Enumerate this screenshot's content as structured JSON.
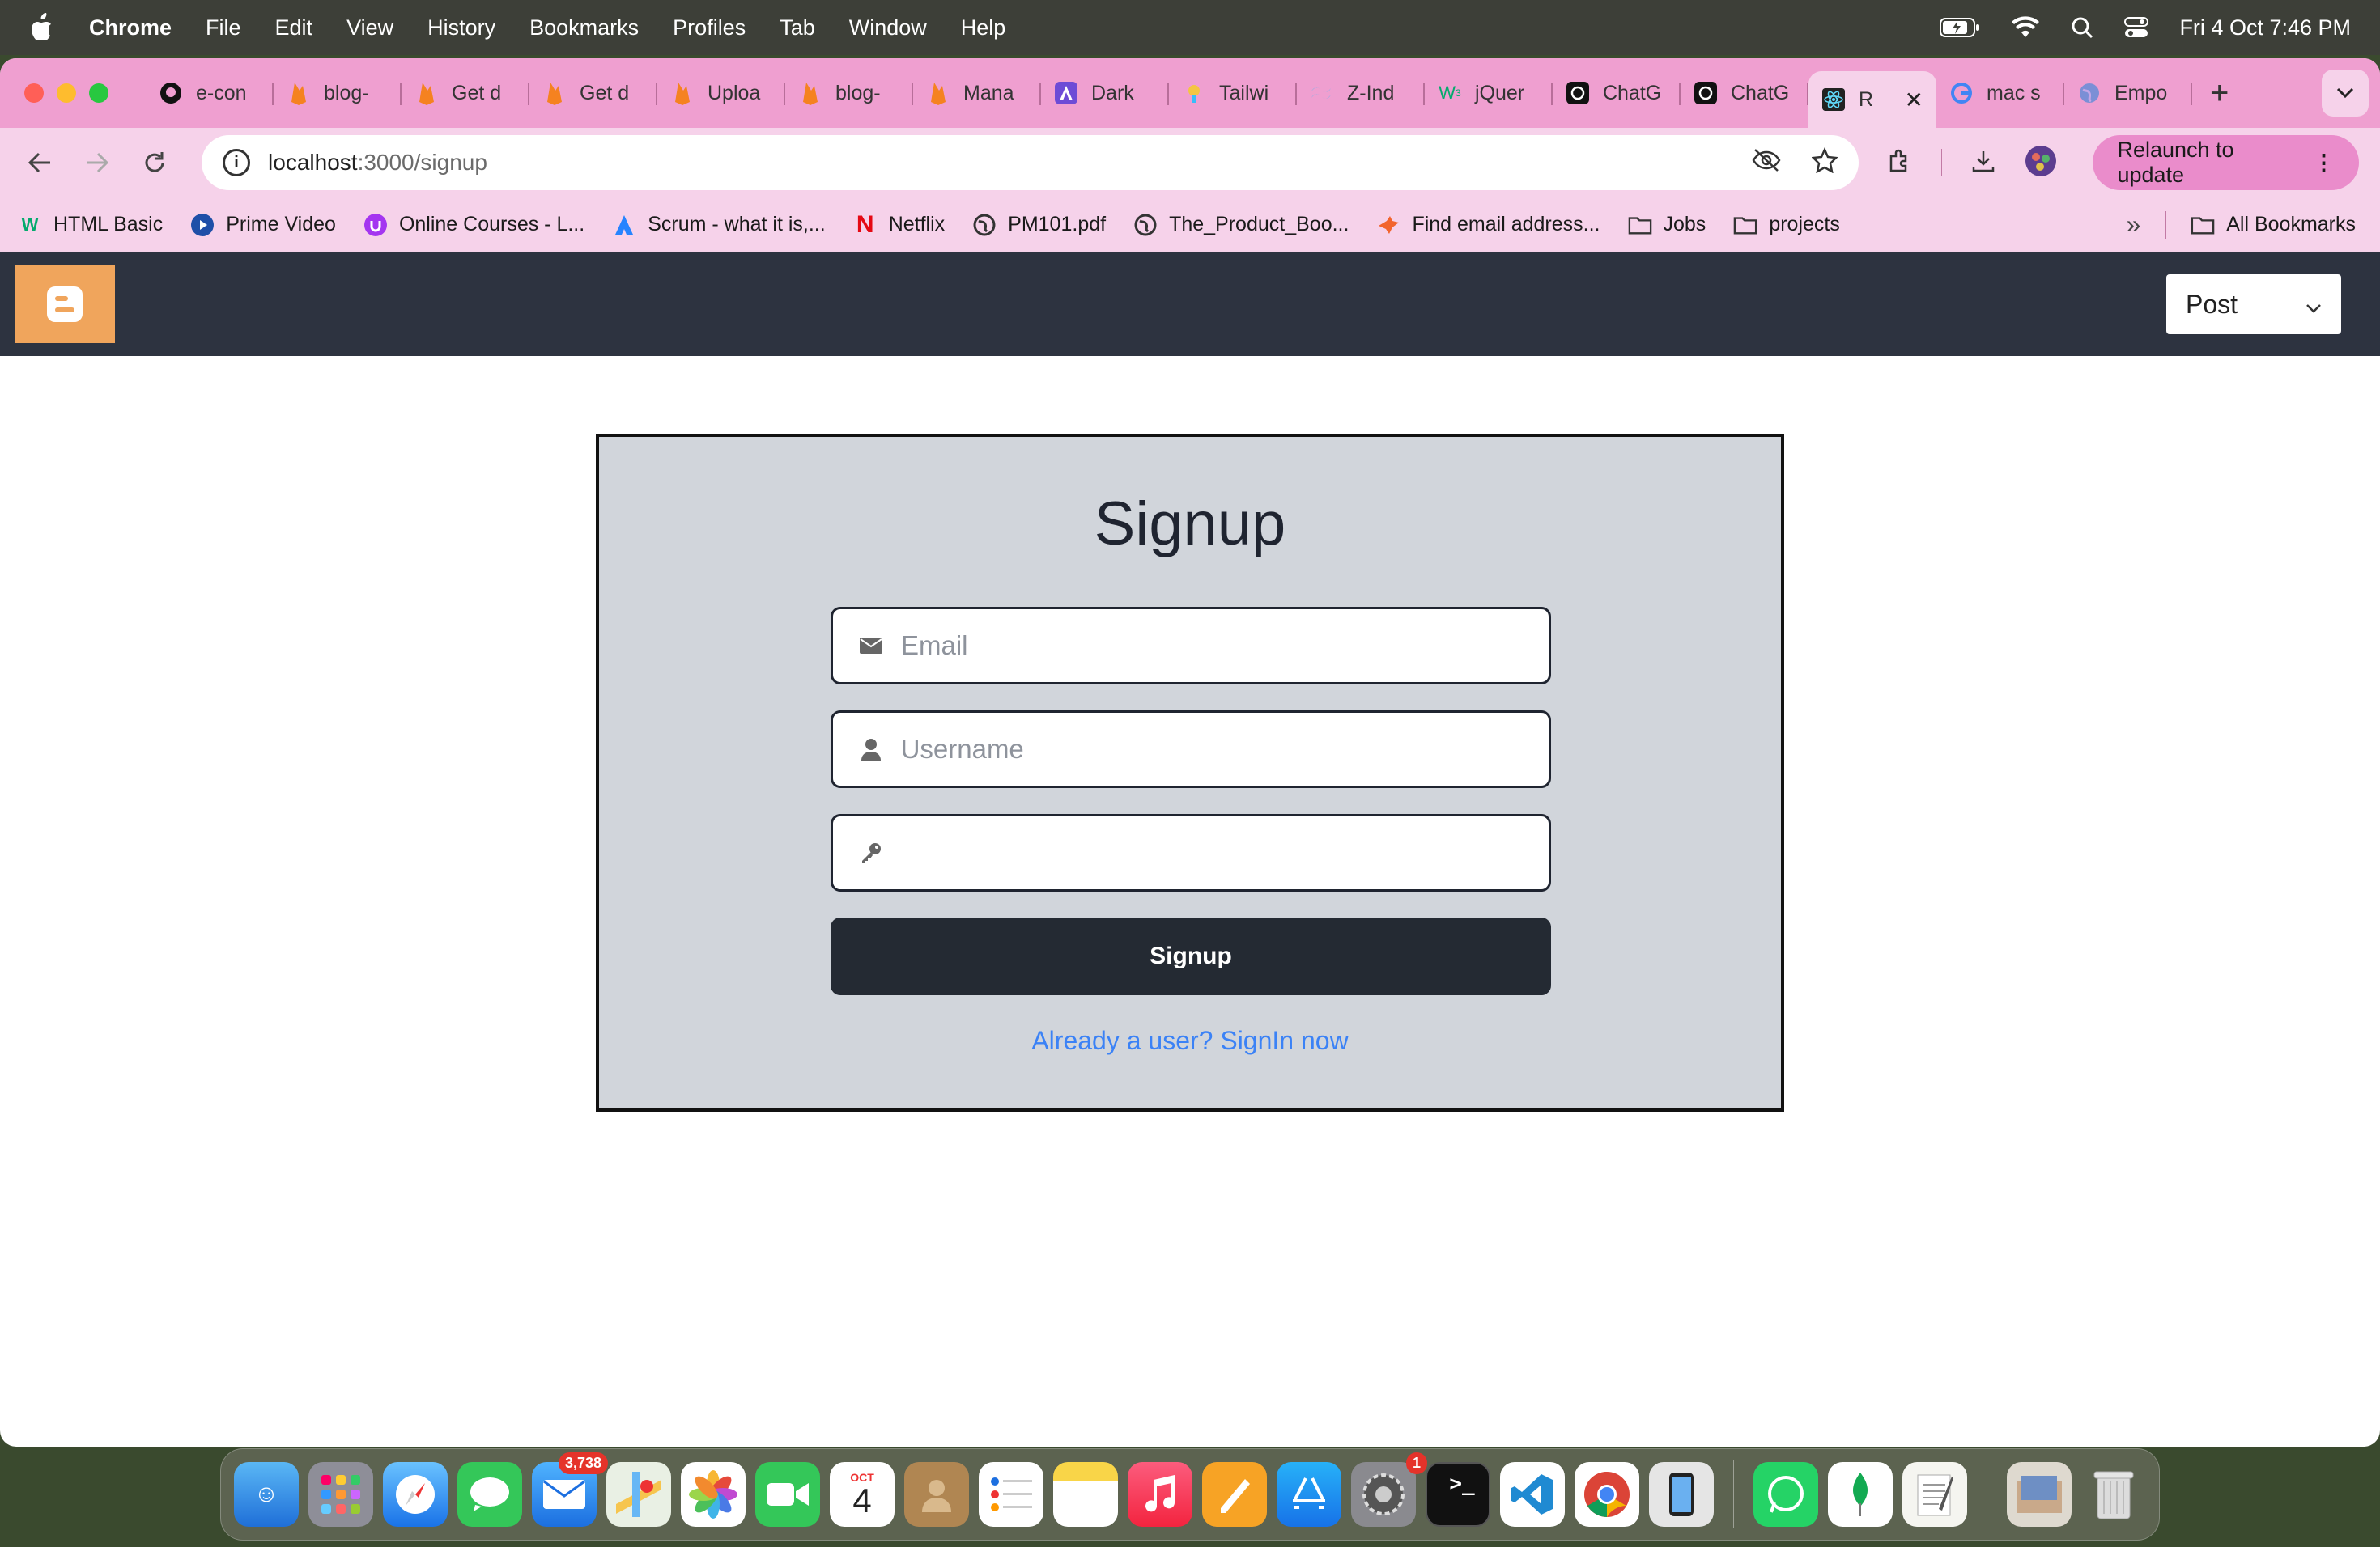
{
  "menubar": {
    "app_name": "Chrome",
    "items": [
      "File",
      "Edit",
      "View",
      "History",
      "Bookmarks",
      "Profiles",
      "Tab",
      "Window",
      "Help"
    ],
    "clock": "Fri 4 Oct  7:46 PM"
  },
  "tabs": [
    {
      "label": "e-con",
      "icon": "github-icon"
    },
    {
      "label": "blog-",
      "icon": "firebase-icon"
    },
    {
      "label": "Get d",
      "icon": "firebase-icon"
    },
    {
      "label": "Get d",
      "icon": "firebase-icon"
    },
    {
      "label": "Uploa",
      "icon": "firebase-icon"
    },
    {
      "label": "blog-",
      "icon": "firebase-icon"
    },
    {
      "label": "Mana",
      "icon": "firebase-icon"
    },
    {
      "label": "Dark",
      "icon": "app-icon"
    },
    {
      "label": "Tailwi",
      "icon": "tailwind-icon"
    },
    {
      "label": "Z-Ind",
      "icon": "tailwind-icon"
    },
    {
      "label": "jQuer",
      "icon": "w3schools-icon"
    },
    {
      "label": "ChatG",
      "icon": "openai-icon"
    },
    {
      "label": "ChatG",
      "icon": "openai-icon"
    },
    {
      "label": "R",
      "icon": "react-icon",
      "active": true
    },
    {
      "label": "mac s",
      "icon": "google-icon"
    },
    {
      "label": "Empo",
      "icon": "globe-icon"
    }
  ],
  "address": {
    "host": "localhost",
    "path": ":3000/signup"
  },
  "relaunch_label": "Relaunch to update",
  "bookmarks": [
    {
      "label": "HTML Basic",
      "icon": "w3schools-icon"
    },
    {
      "label": "Prime Video",
      "icon": "prime-icon"
    },
    {
      "label": "Online Courses - L...",
      "icon": "udemy-icon"
    },
    {
      "label": "Scrum - what it is,...",
      "icon": "atlassian-icon"
    },
    {
      "label": "Netflix",
      "icon": "netflix-icon"
    },
    {
      "label": "PM101.pdf",
      "icon": "globe-icon"
    },
    {
      "label": "The_Product_Boo...",
      "icon": "globe-icon"
    },
    {
      "label": "Find email address...",
      "icon": "hunter-icon"
    },
    {
      "label": "Jobs",
      "icon": "folder-icon"
    },
    {
      "label": "projects",
      "icon": "folder-icon"
    }
  ],
  "all_bookmarks_label": "All Bookmarks",
  "app": {
    "nav_select_value": "Post",
    "form": {
      "title": "Signup",
      "email_placeholder": "Email",
      "username_placeholder": "Username",
      "password_placeholder": "",
      "submit_label": "Signup",
      "signin_link": "Already a user? SignIn now"
    }
  },
  "dock": {
    "mail_badge": "3,738",
    "settings_badge": "1",
    "calendar_month": "OCT",
    "calendar_day": "4"
  },
  "colors": {
    "tabstrip": "#ef9fd0",
    "toolbar": "#f6d2ea",
    "navbar": "#2d3340",
    "logo": "#f0a55c",
    "card": "#d1d5db",
    "button": "#242a33",
    "link": "#3b82f6"
  }
}
